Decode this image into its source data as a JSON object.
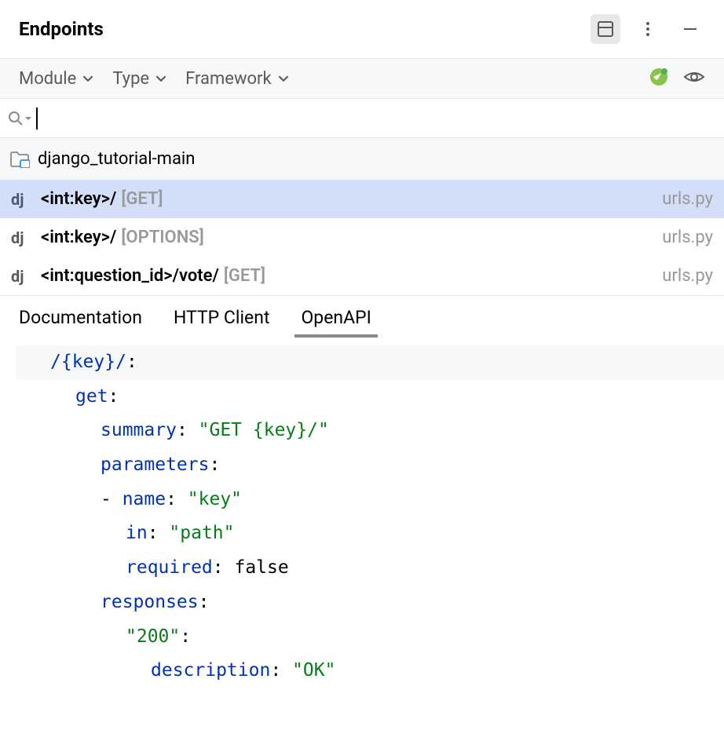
{
  "header": {
    "title": "Endpoints"
  },
  "filters": {
    "module": "Module",
    "type": "Type",
    "framework": "Framework"
  },
  "search": {
    "placeholder": ""
  },
  "project": {
    "name": "django_tutorial-main"
  },
  "endpoints": [
    {
      "icon": "dj",
      "path": "<int:key>/",
      "method": "[GET]",
      "file": "urls.py",
      "selected": true
    },
    {
      "icon": "dj",
      "path": "<int:key>/",
      "method": "[OPTIONS]",
      "file": "urls.py",
      "selected": false
    },
    {
      "icon": "dj",
      "path": "<int:question_id>/vote/",
      "method": "[GET]",
      "file": "urls.py",
      "selected": false
    }
  ],
  "tabs": [
    {
      "label": "Documentation",
      "active": false
    },
    {
      "label": "HTTP Client",
      "active": false
    },
    {
      "label": "OpenAPI",
      "active": true
    }
  ],
  "openapi": {
    "path": "/{key}/",
    "method": "get",
    "summary_key": "summary",
    "summary_value": "\"GET {key}/\"",
    "parameters_key": "parameters",
    "name_key": "name",
    "name_value": "\"key\"",
    "in_key": "in",
    "in_value": "\"path\"",
    "required_key": "required",
    "required_value": "false",
    "responses_key": "responses",
    "code_200": "\"200\"",
    "description_key": "description",
    "description_value": "\"OK\""
  }
}
